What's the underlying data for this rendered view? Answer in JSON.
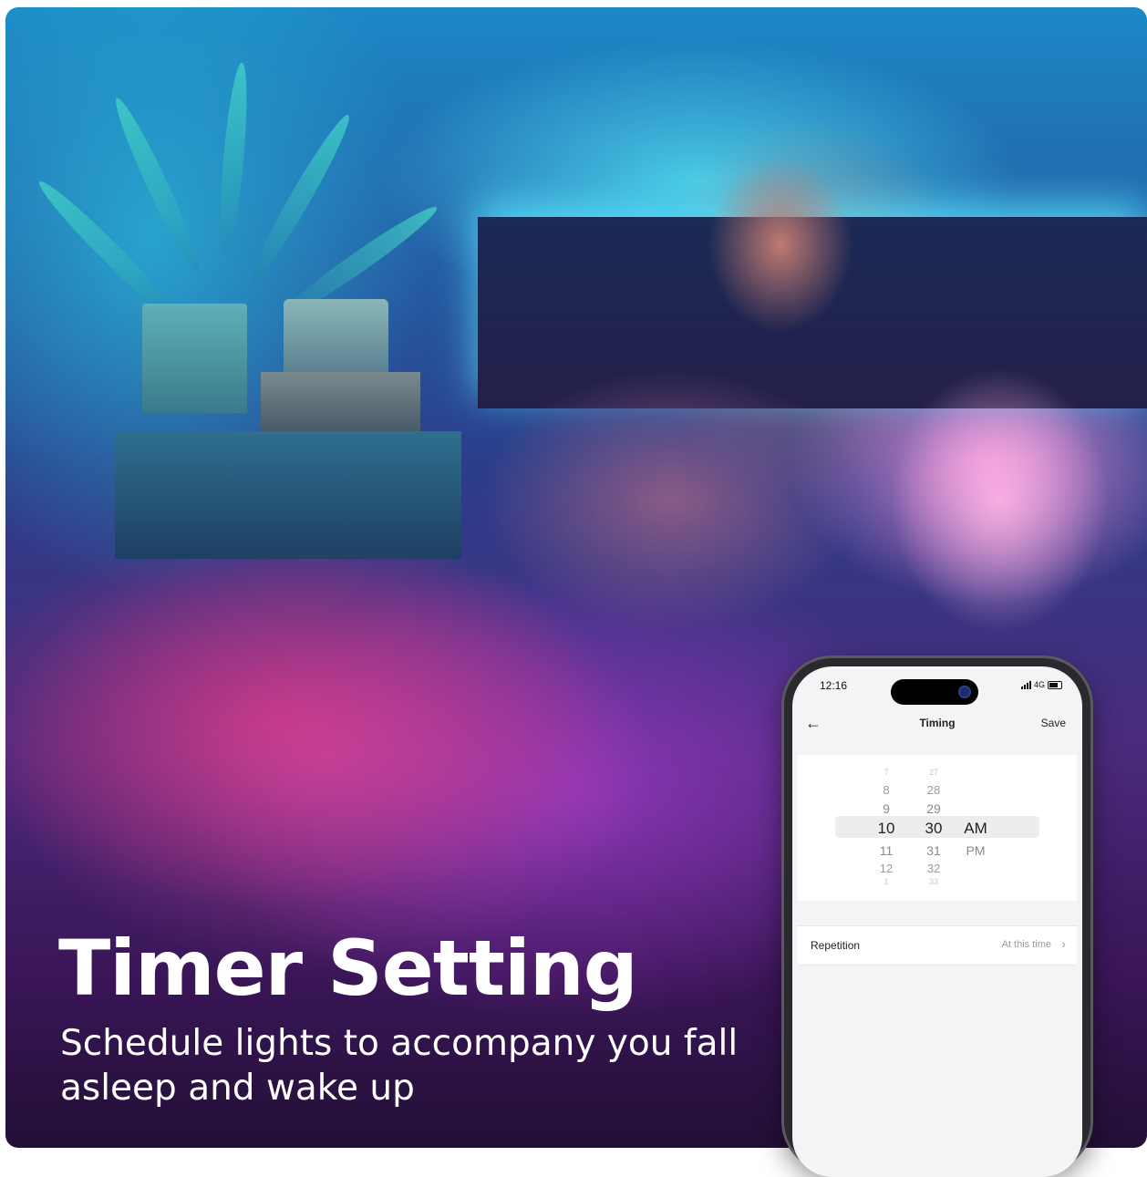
{
  "hero": {
    "headline": "Timer Setting",
    "subtitle": "Schedule lights to accompany you fall asleep and wake up"
  },
  "phone": {
    "status_bar": {
      "time": "12:16",
      "network": "4G",
      "icons": [
        "signal-icon",
        "battery-icon"
      ]
    },
    "nav": {
      "back_icon": "arrow-left-icon",
      "title": "Timing",
      "save_label": "Save"
    },
    "time_picker": {
      "hours": [
        "7",
        "8",
        "9",
        "10",
        "11",
        "12",
        "1"
      ],
      "minutes": [
        "27",
        "28",
        "29",
        "30",
        "31",
        "32",
        "33"
      ],
      "periods": [
        "AM",
        "PM"
      ],
      "selected": {
        "hour": "10",
        "minute": "30",
        "period": "AM"
      }
    },
    "repetition": {
      "label": "Repetition",
      "value": "At this time"
    }
  },
  "colors": {
    "accent_text": "#ffffff",
    "screen_bg": "#f4f4f6",
    "picker_highlight": "#ededf0"
  }
}
